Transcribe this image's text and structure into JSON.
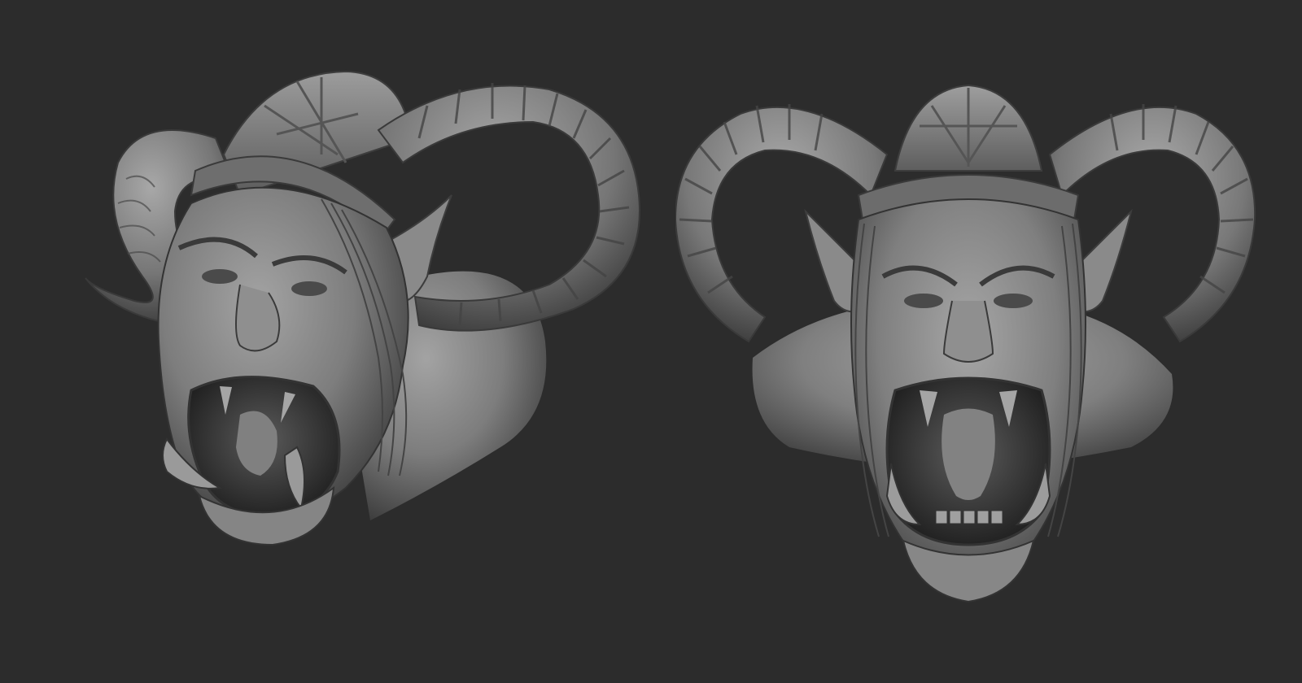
{
  "viewport": {
    "background": "#2c2c2c"
  },
  "renders": [
    {
      "name": "orc-bust-three-quarter-view",
      "material": "#8f8f8f"
    },
    {
      "name": "orc-bust-front-view",
      "material": "#8f8f8f"
    }
  ]
}
